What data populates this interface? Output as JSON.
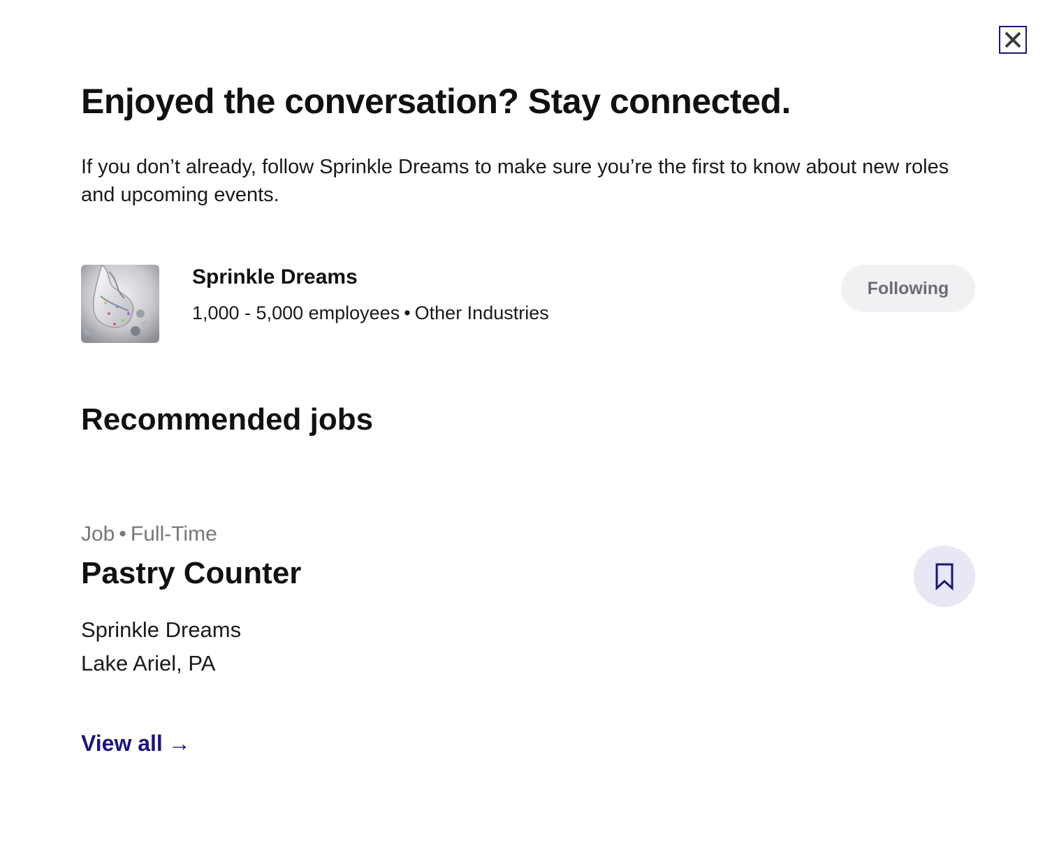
{
  "modal": {
    "close_icon": "close-icon",
    "headline": "Enjoyed the conversation? Stay connected.",
    "intro": "If you don’t already, follow Sprinkle Dreams to make sure you’re the first to know about new roles and upcoming events."
  },
  "company": {
    "logo_icon": "company-logo-image",
    "name": "Sprinkle Dreams",
    "employees": "1,000 - 5,000 employees",
    "separator": "•",
    "industry": "Other Industries",
    "follow_label": "Following"
  },
  "recommended": {
    "title": "Recommended jobs",
    "jobs": [
      {
        "type": "Job",
        "separator": "•",
        "schedule": "Full-Time",
        "title": "Pastry Counter",
        "company": "Sprinkle Dreams",
        "location": "Lake Ariel, PA",
        "bookmark_icon": "bookmark-icon"
      }
    ],
    "view_all_label": "View all",
    "view_all_arrow": "→"
  },
  "colors": {
    "accent": "#1b1678",
    "following_bg": "#f1f1f4",
    "bookmark_bg": "#e8e7f5",
    "muted_text": "#76767c"
  }
}
